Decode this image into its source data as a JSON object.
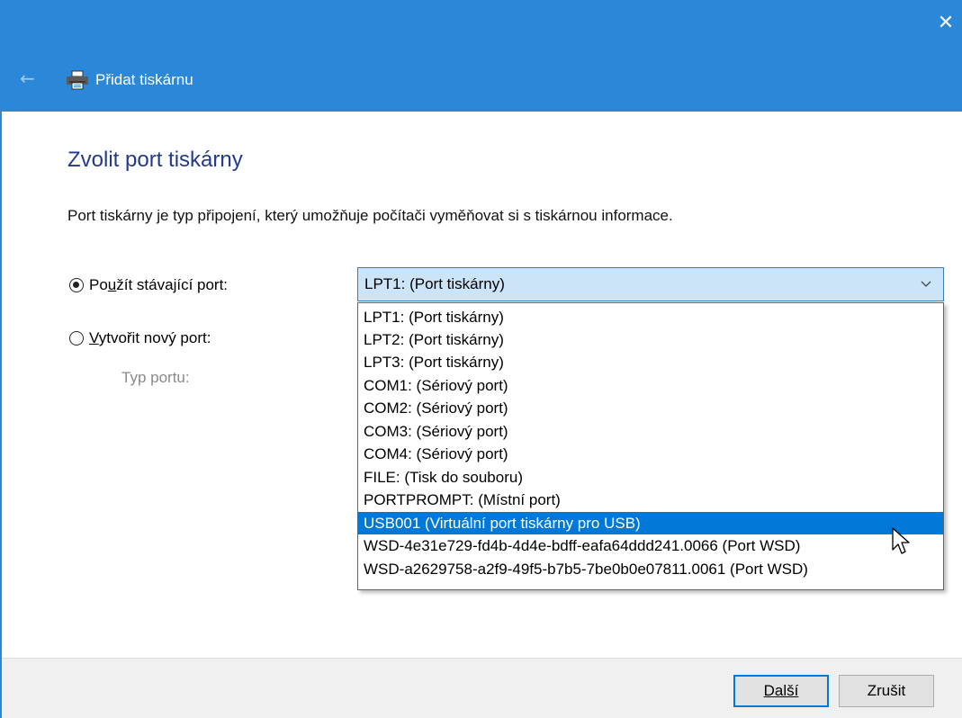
{
  "window": {
    "title": "Přidat tiskárnu",
    "close_glyph": "✕",
    "back_glyph": "←",
    "title_bar_color": "#2b88d8"
  },
  "main": {
    "heading": "Zvolit port tiskárny",
    "description": "Port tiskárny je typ připojení, který umožňuje počítači vyměňovat si s tiskárnou informace.",
    "existing_port": {
      "label_prefix": "Po",
      "label_accel": "u",
      "label_rest": "žít stávající port:",
      "selected": true
    },
    "new_port": {
      "label_accel": "V",
      "label_rest": "ytvořit nový port:",
      "selected": false
    },
    "port_type_label": "Typ portu:",
    "port_select": {
      "value": "LPT1: (Port tiskárny)",
      "options": [
        "LPT1: (Port tiskárny)",
        "LPT2: (Port tiskárny)",
        "LPT3: (Port tiskárny)",
        "COM1: (Sériový port)",
        "COM2: (Sériový port)",
        "COM3: (Sériový port)",
        "COM4: (Sériový port)",
        "FILE: (Tisk do souboru)",
        "PORTPROMPT: (Místní port)",
        "USB001 (Virtuální port tiskárny pro USB)",
        "WSD-4e31e729-fd4b-4d4e-bdff-eafa64ddd241.0066 (Port WSD)",
        "WSD-a2629758-a2f9-49f5-b7b5-7be0b0e07811.0061 (Port WSD)"
      ],
      "highlighted_option": "USB001 (Virtuální port tiskárny pro USB)"
    }
  },
  "footer": {
    "next_label": "Další",
    "cancel_label": "Zrušit"
  },
  "icons": {
    "printer": "printer-icon",
    "chevron": "chevron-down-icon",
    "cursor": "mouse-pointer-icon"
  },
  "colors": {
    "heading": "#233a8c",
    "accent": "#0078d7",
    "select_bg": "#cce4f7"
  }
}
